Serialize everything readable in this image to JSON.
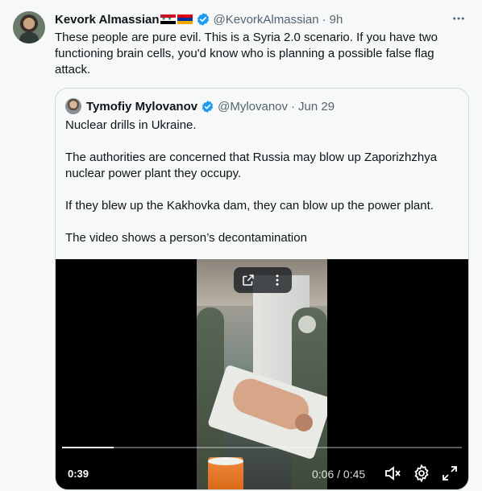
{
  "tweet": {
    "author_name": "Kevork Almassian",
    "handle": "@KevorkAlmassian",
    "separator": "·",
    "time": "9h",
    "more_icon": "more-horizontal-icon",
    "text": "These people are pure evil. This is a Syria 2.0 scenario. If you have two functioning brain cells, you'd know who is planning a possible false flag attack."
  },
  "quote": {
    "author_name": "Tymofiy Mylovanov",
    "handle": "@Mylovanov",
    "separator": "·",
    "time": "Jun 29",
    "paragraphs": [
      "Nuclear drills in Ukraine.",
      "The authorities are concerned that Russia may blow up Zaporizhzhya nuclear power plant they occupy.",
      "If they blew up the Kakhovka dam, they can blow up the power plant.",
      "The video shows a person’s decontamination"
    ]
  },
  "video": {
    "remaining": "0:39",
    "timecode": "0:06 / 0:45",
    "progress": 0.13,
    "icons": {
      "open": "external-link-icon",
      "more": "more-vertical-icon",
      "mute": "volume-muted-icon",
      "settings": "gear-icon",
      "fullscreen": "fullscreen-icon"
    }
  },
  "colors": {
    "verified": "#1d9bf0",
    "secondary_text": "#536471",
    "border": "#cfd9de"
  }
}
